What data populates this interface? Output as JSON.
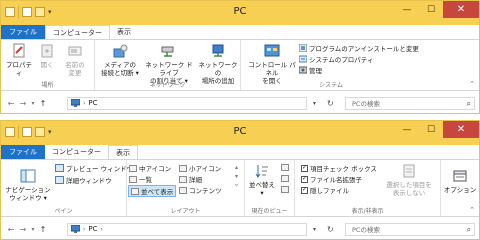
{
  "window1": {
    "title": "PC",
    "tabs": {
      "file": "ファイル",
      "computer": "コンピューター",
      "view": "表示"
    },
    "groups": {
      "location": {
        "label": "場所",
        "properties": "プロパティ",
        "open": "開く",
        "rename_1": "名前の",
        "rename_2": "変更"
      },
      "network": {
        "label": "ネットワーク",
        "access_media_1": "メディアの",
        "access_media_2": "接続と切断 ▾",
        "map_drive_1": "ネットワーク ドライブ",
        "map_drive_2": "の割り当て ▾",
        "add_location_1": "ネットワークの",
        "add_location_2": "場所の追加"
      },
      "system": {
        "label": "システム",
        "control_panel_1": "コントロール パネル",
        "control_panel_2": "を開く",
        "uninstall": "プログラムのアンインストールと変更",
        "system_properties": "システムのプロパティ",
        "manage": "管理"
      }
    },
    "address": {
      "path": "PC",
      "search_placeholder": "PCの検索"
    }
  },
  "window2": {
    "title": "PC",
    "tabs": {
      "file": "ファイル",
      "computer": "コンピューター",
      "view": "表示"
    },
    "groups": {
      "panes": {
        "label": "ペイン",
        "nav_pane_1": "ナビゲーション",
        "nav_pane_2": "ウィンドウ ▾",
        "preview_pane": "プレビュー ウィンドウ",
        "details_pane": "詳細ウィンドウ"
      },
      "layout": {
        "label": "レイアウト",
        "medium_icons": "中アイコン",
        "small_icons": "小アイコン",
        "list": "一覧",
        "details": "詳細",
        "tiles": "並べて表示",
        "content": "コンテンツ"
      },
      "current_view": {
        "label": "現在のビュー",
        "sort_1": "並べ替え",
        "sort_2": "▾"
      },
      "show_hide": {
        "label": "表示/非表示",
        "item_checkboxes": "項目チェック ボックス",
        "file_extensions": "ファイル名拡張子",
        "hidden_items": "隠しファイル",
        "hide_selected_1": "選択した項目を",
        "hide_selected_2": "表示しない"
      },
      "options": {
        "label": "オプション"
      }
    },
    "address": {
      "path": "PC",
      "search_placeholder": "PCの検索"
    }
  },
  "colors": {
    "titlebar": "#f7cf52",
    "file_tab": "#1e72c9",
    "close": "#c7463d"
  }
}
